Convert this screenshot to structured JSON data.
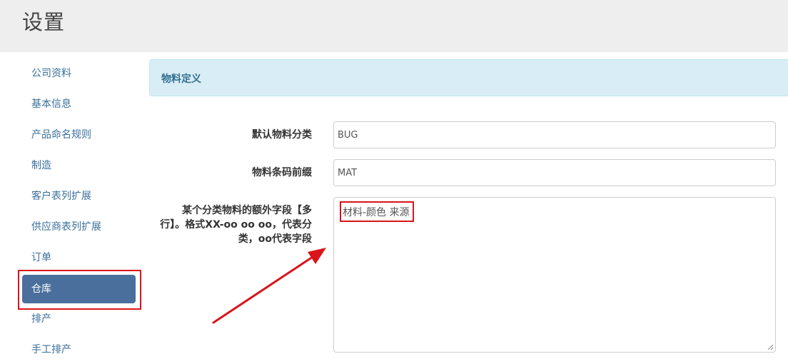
{
  "header": {
    "title": "设置"
  },
  "sidebar": {
    "items": [
      {
        "label": "公司资料"
      },
      {
        "label": "基本信息"
      },
      {
        "label": "产品命名规则"
      },
      {
        "label": "制造"
      },
      {
        "label": "客户表列扩展"
      },
      {
        "label": "供应商表列扩展"
      },
      {
        "label": "订单"
      },
      {
        "label": "仓库",
        "active": true
      },
      {
        "label": "排产"
      },
      {
        "label": "手工排产"
      }
    ]
  },
  "panel": {
    "title": "物料定义",
    "fields": {
      "default_category": {
        "label": "默认物料分类",
        "value": "BUG"
      },
      "barcode_prefix": {
        "label": "物料条码前缀",
        "value": "MAT"
      },
      "extra_fields": {
        "label_line1": "某个分类物料的额外字段【多",
        "label_line2": "行】。格式XX-oo oo oo，代表分",
        "label_line3": "类，oo代表字段",
        "value": "材料-颜色 来源"
      }
    }
  },
  "colors": {
    "accent": "#4a6f9c",
    "link": "#3a6f9a",
    "annotation": "#d9141a",
    "panel_bg": "#d9edf7",
    "panel_text": "#31708f"
  }
}
